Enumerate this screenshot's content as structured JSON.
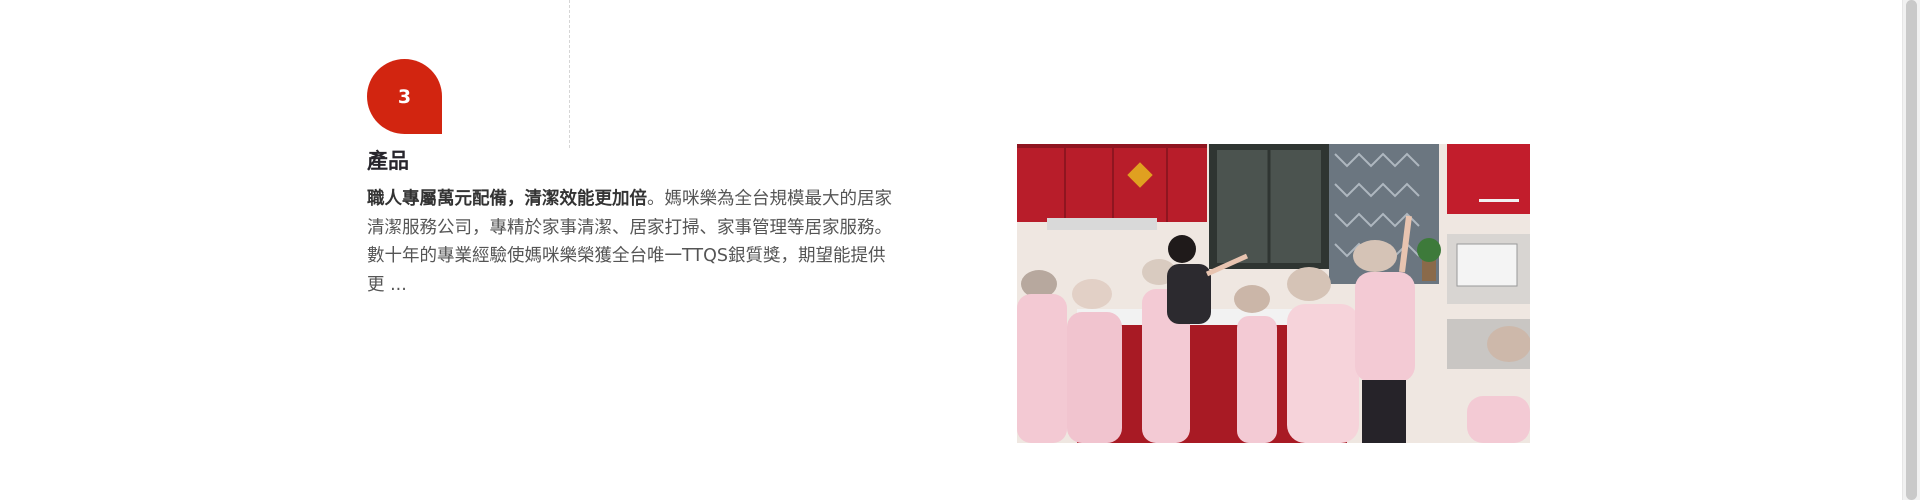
{
  "feature": {
    "number": "3",
    "title": "產品",
    "description_bold": "職人專屬萬元配備，清潔效能更加倍",
    "description_line1_rest": "。媽咪樂為全台規模最大的居家",
    "description_line2": "清潔服務公司，專精於家事清潔、居家打掃、家事管理等居家服務。",
    "description_line3": "數十年的專業經驗使媽咪樂榮獲全台唯一TTQS銀質獎，期望能提供",
    "description_line4": "更 ..."
  },
  "image": {
    "subject": "cleaning staff training in a kitchen"
  },
  "colors": {
    "accent": "#d22510",
    "title": "#27252c",
    "body_text": "#555555"
  }
}
